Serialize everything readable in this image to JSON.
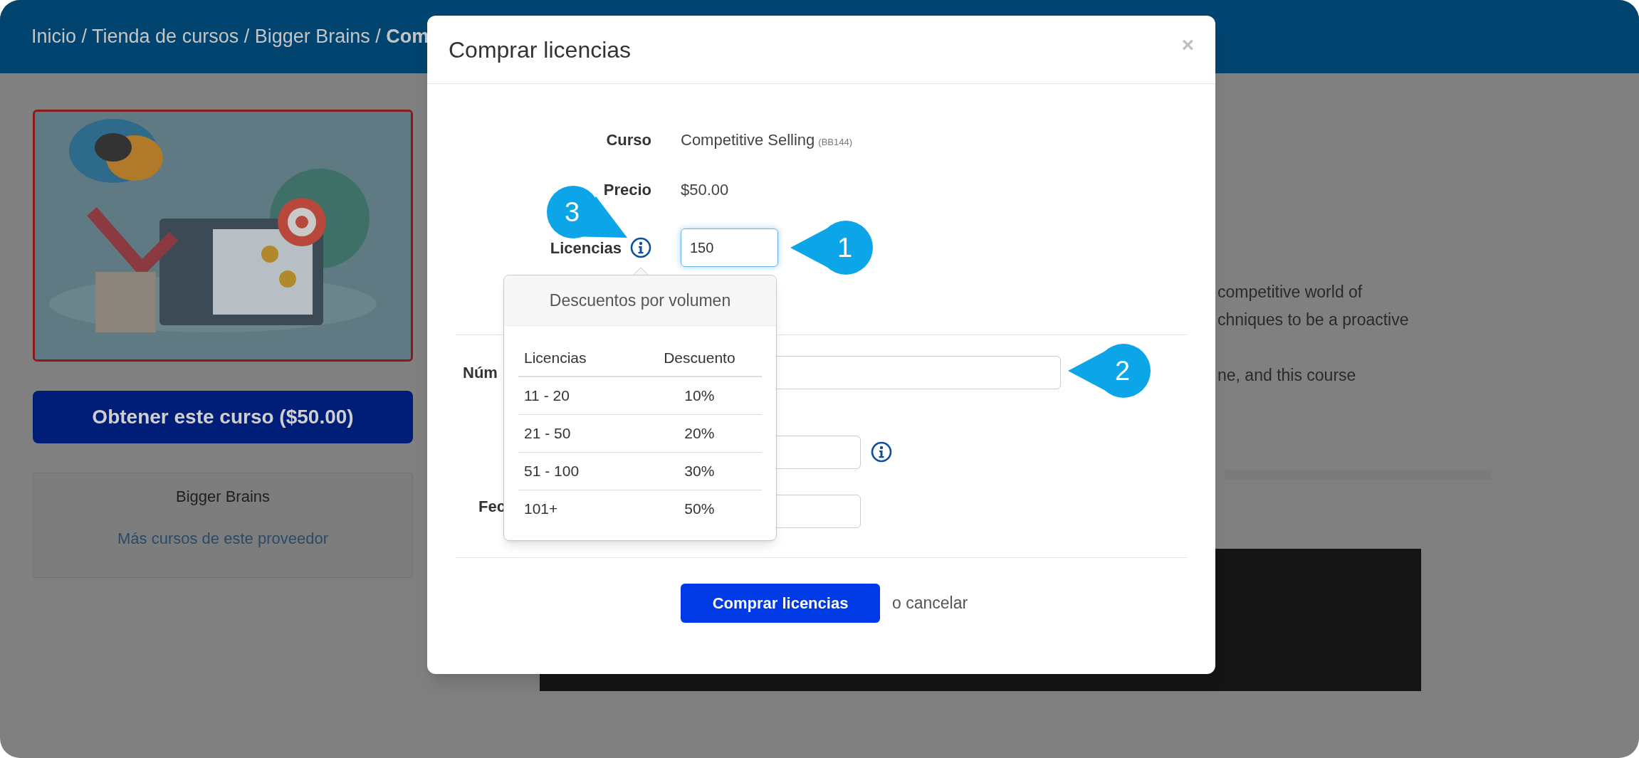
{
  "breadcrumb": "Inicio / Tienda de cursos / Bigger Brains / **Com**",
  "course_image": {
    "kind": "picture"
  },
  "get_course_button": "Obtener este curso ($50.00)",
  "provider_card": {
    "name": "Bigger Brains",
    "link": "Más cursos de este proveedor"
  },
  "description_lines": [
    "competitive world of",
    "chniques to be a proactive",
    "ne, and this course"
  ],
  "modal": {
    "title": "Comprar licencias",
    "close": "×",
    "fields": [
      {
        "label": "Curso",
        "value": "Competitive Selling",
        "code": "(BB144)"
      },
      {
        "label": "Precio",
        "value": "$50.00"
      }
    ],
    "licenses": {
      "label": "Licencias",
      "value": "150",
      "focused": true
    },
    "more_fields": [
      {
        "kind": "wide",
        "label": "Núm"
      },
      {
        "kind": "info"
      },
      {
        "kind": "narrow",
        "label": "Fec"
      }
    ],
    "submit_button": "Comprar licencias",
    "cancel_link": "o cancelar"
  },
  "popover": {
    "title": "Descuentos por volumen",
    "columns": [
      "Licencias",
      "Descuento"
    ],
    "rows": [
      [
        "11 - 20",
        "10%"
      ],
      [
        "21 - 50",
        "20%"
      ],
      [
        "51 - 100",
        "30%"
      ],
      [
        "101+",
        "50%"
      ]
    ]
  },
  "callouts": [
    {
      "number": "3",
      "kind": "tail"
    },
    {
      "number": "1",
      "kind": "arrow"
    },
    {
      "number": "2",
      "kind": "arrow"
    }
  ]
}
